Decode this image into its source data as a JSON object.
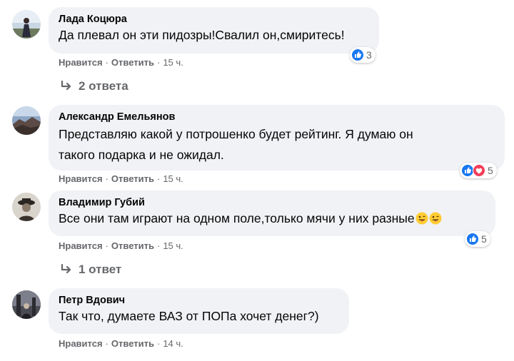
{
  "comments": [
    {
      "author": "Лада Коцюра",
      "text": "Да плевал он эти пидозры!Свалил он,смиритесь!",
      "like_label": "Нравится",
      "reply_label": "Ответить",
      "time": "15 ч.",
      "reactions": [
        "like"
      ],
      "reaction_count": "3",
      "replies_label": "2 ответа"
    },
    {
      "author": "Александр Емельянов",
      "text_line1": "Представляю какой у потрошенко будет рейтинг. Я думаю он",
      "text_line2": "такого подарка и не ожидал.",
      "like_label": "Нравится",
      "reply_label": "Ответить",
      "time": "15 ч.",
      "reactions": [
        "like",
        "love"
      ],
      "reaction_count": "5"
    },
    {
      "author": "Владимир Губий",
      "text": "Все они там играют на одном поле,только мячи у них разные",
      "emojis": [
        "winking-tongue-face",
        "winking-tongue-face"
      ],
      "like_label": "Нравится",
      "reply_label": "Ответить",
      "time": "15 ч.",
      "reactions": [
        "like"
      ],
      "reaction_count": "5",
      "replies_label": "1 ответ"
    },
    {
      "author": "Петр Вдович",
      "text": "Так что, думаете ВАЗ от ПОПа хочет денег?)",
      "like_label": "Нравится",
      "reply_label": "Ответить",
      "time": "14 ч."
    }
  ],
  "colors": {
    "bubble": "#f0f2f5",
    "secondary_text": "#65676b",
    "like_blue": "#1877f2",
    "love_red": "#f33e58"
  }
}
